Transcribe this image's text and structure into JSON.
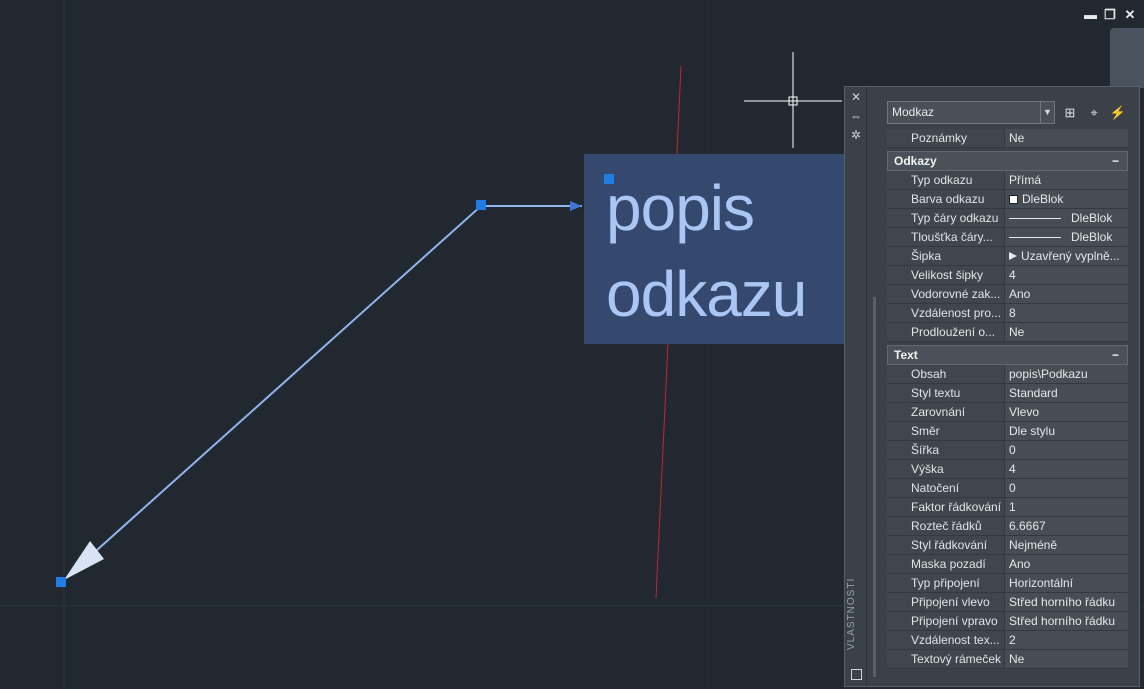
{
  "window": {
    "minimize": "▬",
    "restore": "❐",
    "close": "✕"
  },
  "mtext": {
    "line1": "popis",
    "line2": "odkazu"
  },
  "palette": {
    "side_title": "VLASTNOSTI",
    "object_type": "Modkaz",
    "top_icons": [
      "select-objects-icon",
      "pick-icon",
      "quick-select-icon"
    ],
    "general": [
      {
        "label": "Poznámky",
        "value": "Ne"
      }
    ],
    "leaders_section": {
      "title": "Odkazy",
      "toggle": "−"
    },
    "leaders": [
      {
        "label": "Typ odkazu",
        "value": "Přímá"
      },
      {
        "label": "Barva odkazu",
        "value": "DleBlok"
      },
      {
        "label": "Typ čáry odkazu",
        "value": "DleBlok"
      },
      {
        "label": "Tloušťka čáry...",
        "value": "DleBlok"
      },
      {
        "label": "Šipka",
        "value": "Uzavřený vyplně..."
      },
      {
        "label": "Velikost šipky",
        "value": "4"
      },
      {
        "label": "Vodorovné zak...",
        "value": "Ano"
      },
      {
        "label": "Vzdálenost pro...",
        "value": "8"
      },
      {
        "label": "Prodloužení o...",
        "value": "Ne"
      }
    ],
    "text_section": {
      "title": "Text",
      "toggle": "−"
    },
    "text": [
      {
        "label": "Obsah",
        "value": "popis\\Podkazu"
      },
      {
        "label": "Styl textu",
        "value": "Standard"
      },
      {
        "label": "Zarovnání",
        "value": "Vlevo"
      },
      {
        "label": "Směr",
        "value": "Dle stylu"
      },
      {
        "label": "Šířka",
        "value": "0"
      },
      {
        "label": "Výška",
        "value": "4"
      },
      {
        "label": "Natočení",
        "value": "0"
      },
      {
        "label": "Faktor řádkování",
        "value": "1"
      },
      {
        "label": "Rozteč řádků",
        "value": "6.6667"
      },
      {
        "label": "Styl řádkování",
        "value": "Nejméně"
      },
      {
        "label": "Maska pozadí",
        "value": "Ano"
      },
      {
        "label": "Typ připojení",
        "value": "Horizontální"
      },
      {
        "label": "Připojení vlevo",
        "value": "Střed horního řádku"
      },
      {
        "label": "Připojení vpravo",
        "value": "Střed horního řádku"
      },
      {
        "label": "Vzdálenost tex...",
        "value": "2"
      },
      {
        "label": "Textový rámeček",
        "value": "Ne"
      }
    ]
  },
  "colors": {
    "background": "#212830",
    "leader": "#8fb4ee",
    "grip": "#1f7ee6",
    "mtext_bg": "#35496e",
    "red_line": "#c0282b"
  }
}
